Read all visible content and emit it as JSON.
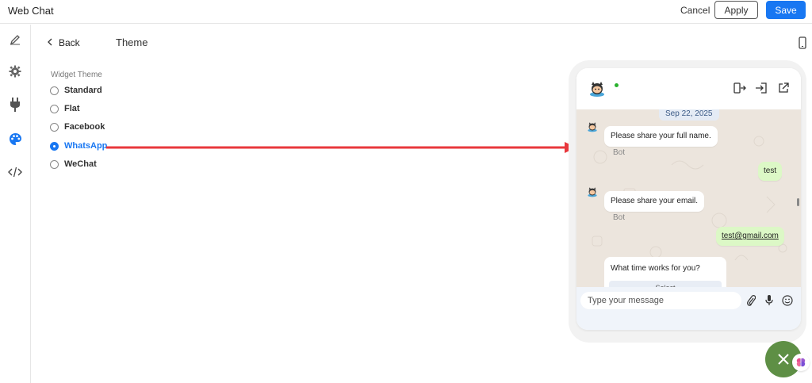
{
  "header": {
    "app_title": "Web Chat",
    "cancel_label": "Cancel",
    "apply_label": "Apply",
    "save_label": "Save",
    "save_color": "#1877f2"
  },
  "sidebar": {
    "items": [
      {
        "name": "pencil-icon",
        "active": false
      },
      {
        "name": "gear-icon",
        "active": false
      },
      {
        "name": "plug-icon",
        "active": false
      },
      {
        "name": "palette-icon",
        "active": true
      },
      {
        "name": "code-icon",
        "active": false
      }
    ],
    "active_color": "#1877f2"
  },
  "page": {
    "back_label": "Back",
    "title": "Theme",
    "device_toggle_icon": "mobile-phone-icon"
  },
  "theme_selector": {
    "label": "Widget Theme",
    "options": [
      {
        "label": "Standard",
        "selected": false
      },
      {
        "label": "Flat",
        "selected": false
      },
      {
        "label": "Facebook",
        "selected": false
      },
      {
        "label": "WhatsApp",
        "selected": true
      },
      {
        "label": "WeChat",
        "selected": false
      }
    ]
  },
  "annotation": {
    "arrow_color": "#e8383d"
  },
  "chat_preview": {
    "status_color": "#29b12d",
    "header_icons": [
      "switch-icon",
      "login-icon",
      "external-link-icon"
    ],
    "date": "Sep 22, 2025",
    "messages": [
      {
        "from": "bot",
        "text": "Please share your full name.",
        "sender": "Bot"
      },
      {
        "from": "user",
        "text": "test"
      },
      {
        "from": "bot",
        "text": "Please share your email.",
        "sender": "Bot"
      },
      {
        "from": "user",
        "text": "test@gmail.com"
      },
      {
        "from": "bot",
        "text": "What time works for you?",
        "select_text": "Select"
      }
    ],
    "composer": {
      "placeholder": "Type your message",
      "icons": [
        "paperclip-icon",
        "microphone-icon",
        "smiley-icon"
      ]
    },
    "body_color": "#ece5dd",
    "user_bubble_color": "#dcf8c6"
  },
  "launcher": {
    "close_color": "#5e8f45"
  }
}
